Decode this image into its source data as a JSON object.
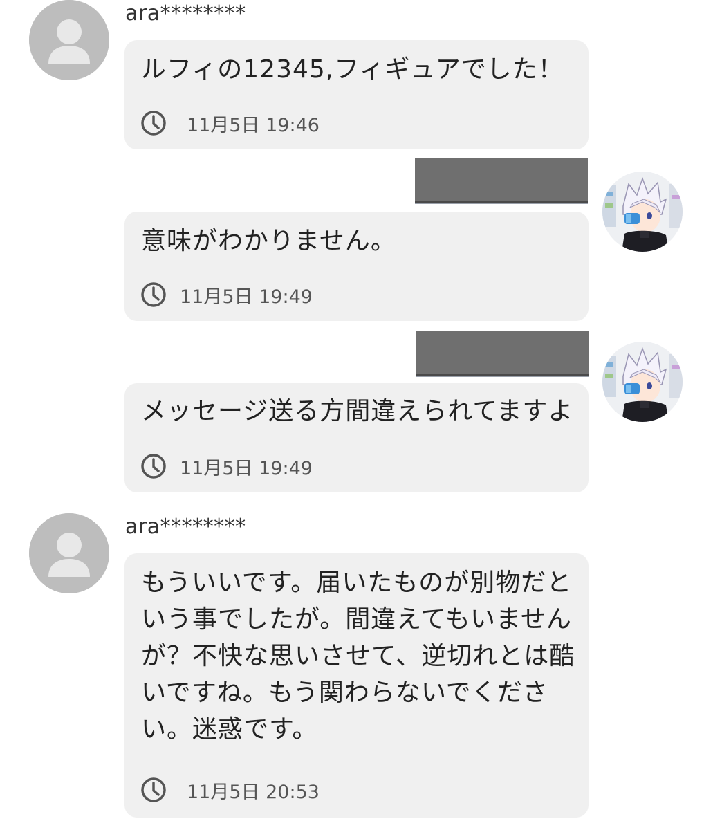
{
  "messages": [
    {
      "sender": "ara********",
      "text": "ルフィの12345,フィギュアでした！",
      "time": "11月5日 19:46",
      "side": "left"
    },
    {
      "sender": "",
      "text": "意味がわかりません。",
      "time": "11月5日 19:49",
      "side": "right",
      "name_redacted": true
    },
    {
      "sender": "",
      "text": "メッセージ送る方間違えられてますよ",
      "time": "11月5日 19:49",
      "side": "right",
      "name_redacted": true
    },
    {
      "sender": "ara********",
      "text": "もういいです。届いたものが別物だと\nいう事でしたが。間違えてもいません\nが？不快な思いさせて、逆切れとは酷\nいですね。もう関わらないでくださ\nい。迷惑です。",
      "time": "11月5日 20:53",
      "side": "left"
    }
  ],
  "icons": {
    "default_avatar": "person-silhouette-icon",
    "user_avatar": "anime-character-avatar",
    "clock": "clock-icon"
  },
  "colors": {
    "bubble": "#f0f0f0",
    "avatar_placeholder": "#bdbdbd",
    "redaction": "#6f6f6f"
  }
}
